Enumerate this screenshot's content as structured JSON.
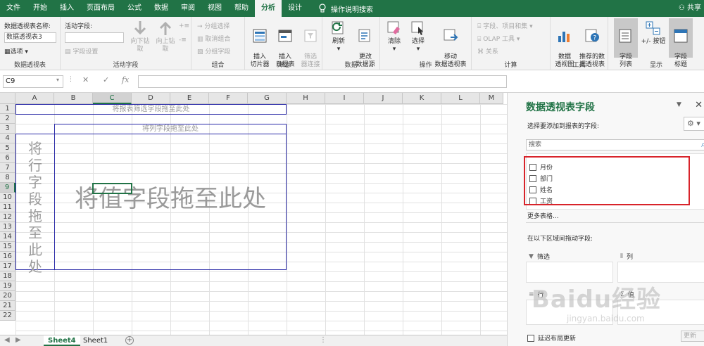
{
  "menu": {
    "tabs": [
      "文件",
      "开始",
      "插入",
      "页面布局",
      "公式",
      "数据",
      "审阅",
      "视图",
      "帮助",
      "分析",
      "设计"
    ],
    "active_tab": "分析",
    "tellme": "操作说明搜索",
    "share": "共享"
  },
  "ribbon": {
    "pivot": {
      "name_label": "数据透视表名称:",
      "name_value": "数据透视表3",
      "options": "选项",
      "group": "数据透视表"
    },
    "active_field": {
      "label": "活动字段:",
      "value": "",
      "settings": "字段设置",
      "drill_down": "向下钻取",
      "drill_up": "向上钻取",
      "group": "活动字段"
    },
    "grouping": {
      "selection": "分组选择",
      "ungroup": "取消组合",
      "field": "分组字段",
      "group": "组合"
    },
    "filter": {
      "slicer": "插入\n切片器",
      "timeline": "插入\n日程表",
      "connections": "筛选\n器连接",
      "group": "筛选"
    },
    "data": {
      "refresh": "刷新",
      "change_source": "更改\n数据源",
      "group": "数据"
    },
    "actions": {
      "clear": "清除",
      "select": "选择",
      "move": "移动\n数据透视表",
      "group": "操作"
    },
    "calc": {
      "fields_items": "字段、项目和集",
      "olap": "OLAP 工具",
      "relations": "关系",
      "group": "计算"
    },
    "tools": {
      "pivot_chart": "数据\n透视图",
      "recommended": "推荐的数\n据透视表",
      "group": "工具"
    },
    "show": {
      "field_list": "字段\n列表",
      "buttons": "+/- 按钮",
      "headers": "字段\n标题",
      "group": "显示"
    }
  },
  "formula_bar": {
    "name_box": "C9",
    "cancel": "✕",
    "enter": "✓",
    "fx": "fx",
    "value": ""
  },
  "grid": {
    "columns": [
      "A",
      "B",
      "C",
      "D",
      "E",
      "F",
      "G",
      "H",
      "I",
      "J",
      "K",
      "L",
      "M"
    ],
    "rows": [
      "1",
      "2",
      "3",
      "4",
      "5",
      "6",
      "7",
      "8",
      "9",
      "10",
      "11",
      "12",
      "13",
      "14",
      "15",
      "16",
      "17",
      "18",
      "19",
      "20",
      "21",
      "22"
    ],
    "selected_col": "C",
    "selected_row": "9",
    "report_filter_hint": "将报表筛选字段拖至此处",
    "col_field_hint": "将列字段拖至此处",
    "row_field_hint": "将行字段拖至此处",
    "value_field_hint": "将值字段拖至此处"
  },
  "sheets": {
    "tabs": [
      "Sheet4",
      "Sheet1"
    ],
    "active": "Sheet4",
    "add": "+"
  },
  "pane": {
    "title": "数据透视表字段",
    "subtitle": "选择要添加到报表的字段:",
    "search_placeholder": "搜索",
    "fields": [
      "月份",
      "部门",
      "姓名",
      "工资"
    ],
    "more_tables": "更多表格...",
    "areas_label": "在以下区域间拖动字段:",
    "areas": {
      "filter": "筛选",
      "columns": "列",
      "rows": "行",
      "values": "值"
    },
    "defer_update": "延迟布局更新",
    "update_button": "更新"
  },
  "watermark": {
    "brand": "Baidu经验",
    "url": "jingyan.baidu.com"
  }
}
